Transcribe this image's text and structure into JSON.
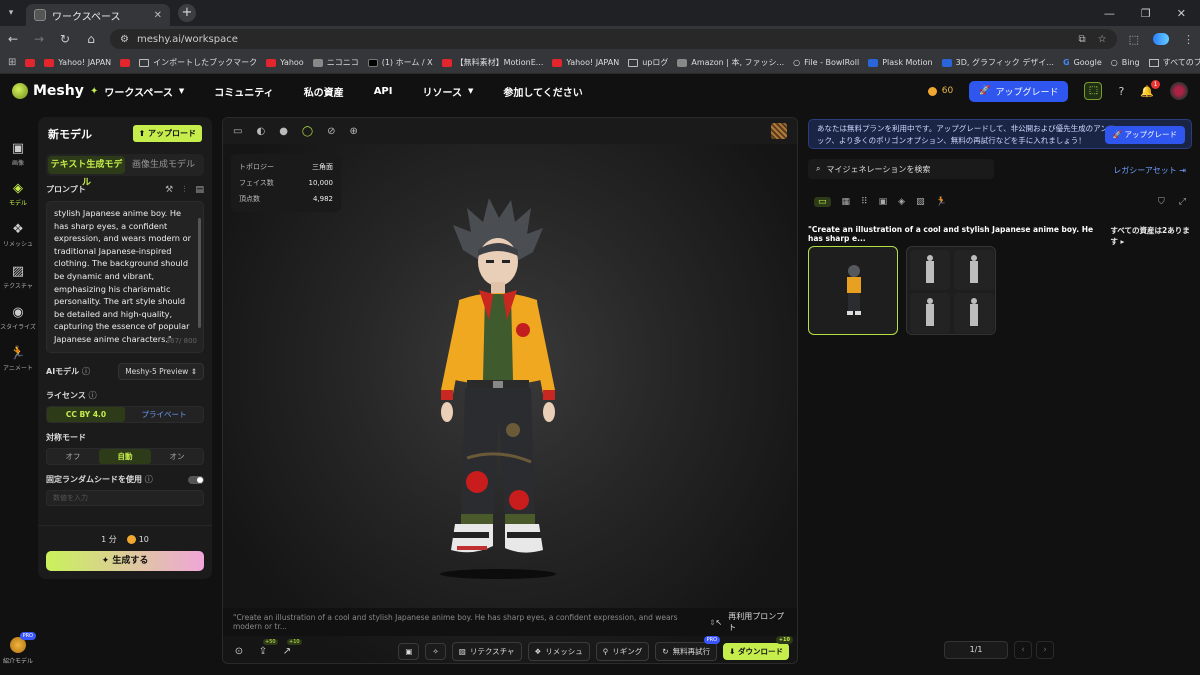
{
  "browser": {
    "tab_title": "ワークスペース",
    "url": "meshy.ai/workspace",
    "bookmarks": [
      {
        "label": "",
        "icon": "youtube-icon"
      },
      {
        "label": "Yahoo! JAPAN",
        "icon": "yahoo-icon"
      },
      {
        "label": "",
        "icon": "youtube-icon"
      },
      {
        "label": "インポートしたブックマーク",
        "icon": "folder-icon"
      },
      {
        "label": "Yahoo",
        "icon": "yahoo-icon"
      },
      {
        "label": "ニコニコ",
        "icon": "niconico-icon"
      },
      {
        "label": "(1) ホーム / X",
        "icon": "x-icon"
      },
      {
        "label": "【無料素材】MotionE...",
        "icon": "motion-icon"
      },
      {
        "label": "Yahoo! JAPAN",
        "icon": "yahoo-icon"
      },
      {
        "label": "upログ",
        "icon": "folder-icon"
      },
      {
        "label": "Amazon | 本, ファッシ...",
        "icon": "amazon-icon"
      },
      {
        "label": "File - BowlRoll",
        "icon": "search-icon"
      },
      {
        "label": "Plask Motion",
        "icon": "plask-icon"
      },
      {
        "label": "3D, グラフィック デザイ...",
        "icon": "cube-icon"
      },
      {
        "label": "Google",
        "icon": "google-icon"
      },
      {
        "label": "Bing",
        "icon": "search-icon"
      }
    ],
    "all_bookmarks": "すべてのブックマーク"
  },
  "header": {
    "logo": "Meshy",
    "nav": {
      "workspace": "ワークスペース",
      "community": "コミュニティ",
      "assets": "私の資産",
      "api": "API",
      "resources": "リソース",
      "join": "参加してください"
    },
    "credits": "60",
    "upgrade": "アップグレード",
    "notifications": "1"
  },
  "rail": {
    "image": "画像",
    "model": "モデル",
    "remesh": "リメッシュ",
    "texture": "テクスチャ",
    "stylize": "スタイライズ",
    "animate": "アニメート",
    "invite": "紹介モデル",
    "pro": "PRO"
  },
  "left_panel": {
    "title": "新モデル",
    "upload": "アップロード",
    "tab_text": "テキスト生成モデル",
    "tab_image": "画像生成モデル",
    "prompt_label": "プロンプト",
    "prompt_text": "stylish Japanese anime boy. He has sharp eyes, a confident expression, and wears modern or traditional Japanese-inspired clothing. The background should be dynamic and vibrant, emphasizing his charismatic personality. The art style should be detailed and high-quality, capturing the essence of popular Japanese anime characters.\"",
    "char_count": "367/ 800",
    "ai_model_label": "AIモデル",
    "ai_model_value": "Meshy-5 Preview",
    "license_label": "ライセンス",
    "license_cc": "CC BY 4.0",
    "license_private": "プライベート",
    "symmetry_label": "対称モード",
    "sym_off": "オフ",
    "sym_auto": "自動",
    "sym_on": "オン",
    "seed_label": "固定ランダムシードを使用",
    "seed_placeholder": "数値を入力",
    "time": "1 分",
    "cost": "10",
    "generate": "生成する"
  },
  "viewport": {
    "stats": {
      "topology_label": "トポロジー",
      "topology_value": "三角面",
      "faces_label": "フェイス数",
      "faces_value": "10,000",
      "vertices_label": "頂点数",
      "vertices_value": "4,982"
    },
    "prompt": "\"Create an illustration of a cool and stylish Japanese anime boy. He has sharp eyes, a confident expression, and wears modern or tr...",
    "reuse_prompt": "再利用プロンプト",
    "badge_50": "+50",
    "badge_10": "+10",
    "retexture": "リテクスチャ",
    "remesh": "リメッシュ",
    "rigging": "リギング",
    "free_retry": "無料再試行",
    "download": "ダウンロード",
    "pro": "PRO",
    "dl_badge": "+10"
  },
  "right_panel": {
    "banner": "あなたは無料プランを利用中です。アップグレードして、非公開および優先生成のアンロック、より多くのポリゴンオプション、無料の再試行などを手に入れましょう！",
    "banner_upgrade": "アップグレード",
    "search_placeholder": "マイジェネレーションを検索",
    "legacy": "レガシーアセット",
    "prompt_title": "\"Create an illustration of a cool and stylish Japanese anime boy. He has sharp e...",
    "all_assets": "すべての資産は2あります",
    "pager": "1/1"
  },
  "colors": {
    "accent": "#c5ee4d",
    "upgrade_blue": "#2f57f0"
  }
}
